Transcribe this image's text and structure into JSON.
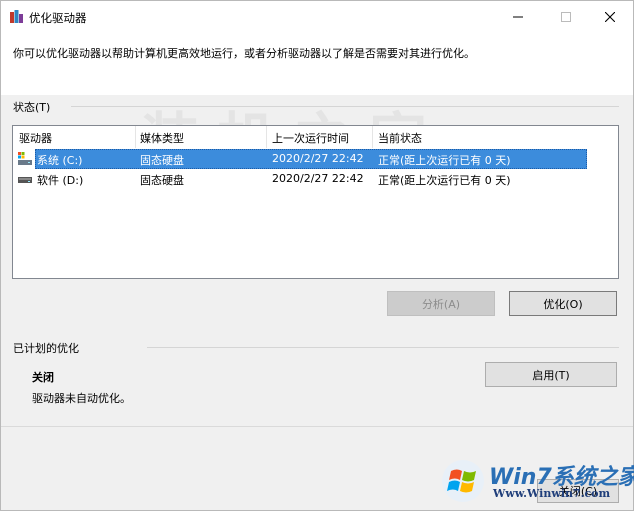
{
  "window": {
    "title": "优化驱动器",
    "description": "你可以优化驱动器以帮助计算机更高效地运行，或者分析驱动器以了解是否需要对其进行优化。"
  },
  "status": {
    "label": "状态(T)",
    "columns": [
      "驱动器",
      "媒体类型",
      "上一次运行时间",
      "当前状态"
    ],
    "rows": [
      {
        "icon": "system-drive-icon",
        "drive": "系统 (C:)",
        "media": "固态硬盘",
        "last_run": "2020/2/27 22:42",
        "state": "正常(距上次运行已有 0 天)",
        "selected": true
      },
      {
        "icon": "drive-icon",
        "drive": "软件 (D:)",
        "media": "固态硬盘",
        "last_run": "2020/2/27 22:42",
        "state": "正常(距上次运行已有 0 天)",
        "selected": false
      }
    ]
  },
  "actions": {
    "analyze_label": "分析(A)",
    "optimize_label": "优化(O)"
  },
  "scheduled": {
    "label": "已计划的优化",
    "state": "关闭",
    "description": "驱动器未自动优化。",
    "enable_label": "启用(T)"
  },
  "footer": {
    "close_label": "关闭(C)"
  },
  "watermark": {
    "text": "装机之家",
    "logo_text": "Win7系统之家",
    "logo_url": "Www.Winwin7.com"
  },
  "colors": {
    "selection": "#3c8cdc",
    "logo_blue": "#2a6fb5"
  }
}
